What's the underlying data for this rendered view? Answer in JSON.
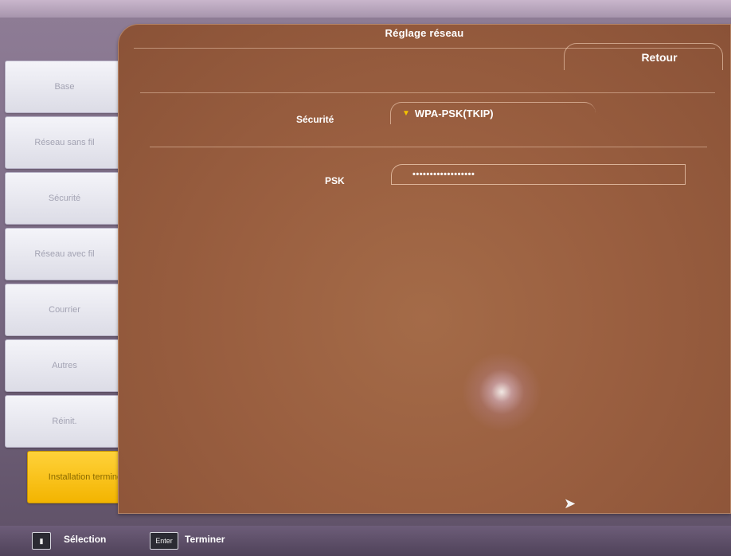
{
  "header": {
    "title": "Réglage réseau",
    "back_label": "Retour"
  },
  "sidebar": {
    "items": [
      {
        "label": "Base"
      },
      {
        "label": "Réseau sans fil"
      },
      {
        "label": "Sécurité"
      },
      {
        "label": "Réseau avec fil"
      },
      {
        "label": "Courrier"
      },
      {
        "label": "Autres"
      },
      {
        "label": "Réinit."
      },
      {
        "label": "Installation terminée",
        "active": true
      }
    ]
  },
  "form": {
    "security_label": "Sécurité",
    "security_value": "WPA-PSK(TKIP)",
    "psk_label": "PSK",
    "psk_value": "••••••••••••••••••"
  },
  "footer": {
    "select_label": "Sélection",
    "enter_key": "Enter",
    "finish_label": "Terminer"
  },
  "colors": {
    "panel": "#9a5f40",
    "sidebar_item": "#f4f4f9",
    "active_item": "#f3b400",
    "text": "#ffffff"
  }
}
